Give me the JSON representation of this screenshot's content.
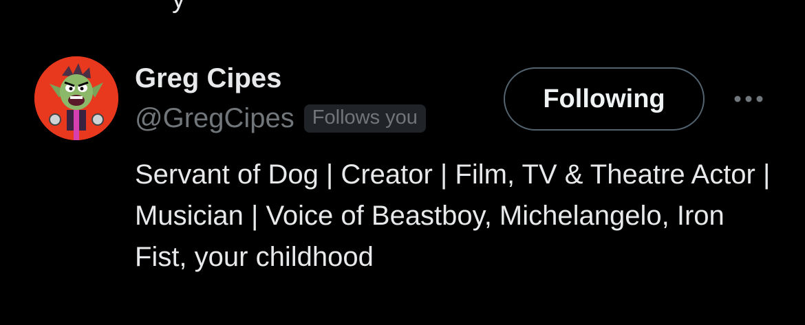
{
  "top_fragment": "y",
  "user": {
    "display_name": "Greg Cipes",
    "handle": "@GregCipes",
    "follows_you_label": "Follows you",
    "bio": "Servant of Dog | Creator | Film, TV & Theatre Actor | Musician | Voice of Beastboy, Michelangelo, Iron Fist, your childhood",
    "avatar_icon": "cartoon-character-avatar"
  },
  "actions": {
    "follow_label": "Following",
    "more_icon": "more-horizontal-icon"
  },
  "colors": {
    "background": "#000000",
    "primary_text": "#e7e9ea",
    "secondary_text": "#71767b",
    "badge_background": "#202327",
    "button_border": "#536471",
    "avatar_background": "#e8391f"
  }
}
